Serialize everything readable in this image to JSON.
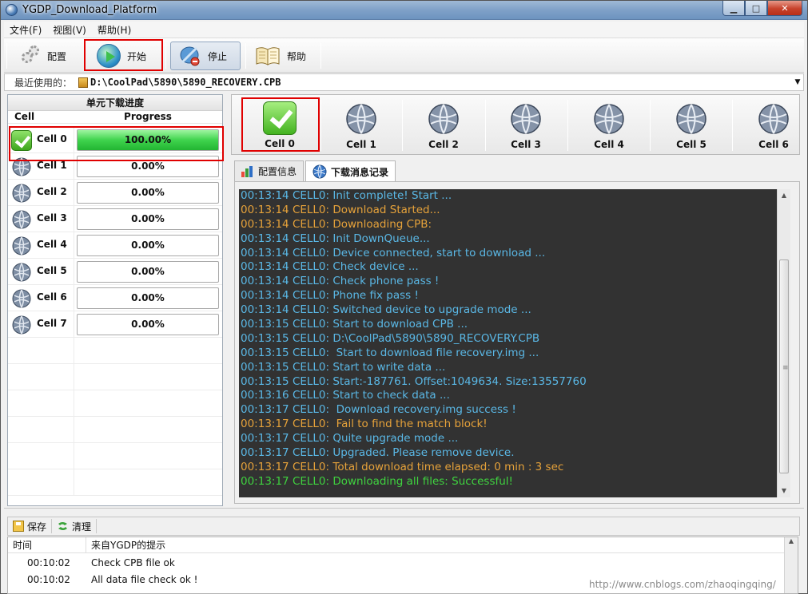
{
  "window": {
    "title": "YGDP_Download_Platform"
  },
  "menu": {
    "items": [
      "文件(F)",
      "视图(V)",
      "帮助(H)"
    ]
  },
  "toolbar": {
    "config": "配置",
    "start": "开始",
    "stop": "停止",
    "help": "帮助"
  },
  "recent": {
    "label": "最近使用的：",
    "path": "D:\\CoolPad\\5890\\5890_RECOVERY.CPB"
  },
  "left_panel": {
    "title": "单元下载进度",
    "col_cell": "Cell",
    "col_progress": "Progress",
    "cells": [
      {
        "name": "Cell 0",
        "progress": "100.00%",
        "done": true
      },
      {
        "name": "Cell 1",
        "progress": "0.00%"
      },
      {
        "name": "Cell 2",
        "progress": "0.00%"
      },
      {
        "name": "Cell 3",
        "progress": "0.00%"
      },
      {
        "name": "Cell 4",
        "progress": "0.00%"
      },
      {
        "name": "Cell 5",
        "progress": "0.00%"
      },
      {
        "name": "Cell 6",
        "progress": "0.00%"
      },
      {
        "name": "Cell 7",
        "progress": "0.00%"
      }
    ]
  },
  "cell_bar": [
    "Cell 0",
    "Cell 1",
    "Cell 2",
    "Cell 3",
    "Cell 4",
    "Cell 5",
    "Cell 6"
  ],
  "tabs": {
    "config_info": "配置信息",
    "download_log": "下载消息记录"
  },
  "log": [
    {
      "time": "00:13:14",
      "text": "CELL0: Init complete! Start ...",
      "color": "#5ab8e6"
    },
    {
      "time": "00:13:14",
      "text": "CELL0: Download Started...",
      "color": "#e6a23a"
    },
    {
      "time": "00:13:14",
      "text": "CELL0: Downloading CPB:",
      "color": "#e6a23a"
    },
    {
      "time": "00:13:14",
      "text": "CELL0: Init DownQueue...",
      "color": "#5ab8e6"
    },
    {
      "time": "00:13:14",
      "text": "CELL0: Device connected, start to download ...",
      "color": "#5ab8e6"
    },
    {
      "time": "00:13:14",
      "text": "CELL0: Check device ...",
      "color": "#5ab8e6"
    },
    {
      "time": "00:13:14",
      "text": "CELL0: Check phone pass !",
      "color": "#5ab8e6"
    },
    {
      "time": "00:13:14",
      "text": "CELL0: Phone fix pass !",
      "color": "#5ab8e6"
    },
    {
      "time": "00:13:14",
      "text": "CELL0: Switched device to upgrade mode ...",
      "color": "#5ab8e6"
    },
    {
      "time": "00:13:15",
      "text": "CELL0: Start to download CPB ...",
      "color": "#5ab8e6"
    },
    {
      "time": "00:13:15",
      "text": "CELL0: D:\\CoolPad\\5890\\5890_RECOVERY.CPB",
      "color": "#5ab8e6"
    },
    {
      "time": "00:13:15",
      "text": "CELL0:  Start to download file recovery.img ...",
      "color": "#5ab8e6"
    },
    {
      "time": "00:13:15",
      "text": "CELL0: Start to write data ...",
      "color": "#5ab8e6"
    },
    {
      "time": "00:13:15",
      "text": "CELL0: Start:-187761. Offset:1049634. Size:13557760",
      "color": "#5ab8e6"
    },
    {
      "time": "00:13:16",
      "text": "CELL0: Start to check data ...",
      "color": "#5ab8e6"
    },
    {
      "time": "00:13:17",
      "text": "CELL0:  Download recovery.img success !",
      "color": "#5ab8e6"
    },
    {
      "time": "00:13:17",
      "text": "CELL0:  Fail to find the match block!",
      "color": "#e6a23a"
    },
    {
      "time": "00:13:17",
      "text": "CELL0: Quite upgrade mode ...",
      "color": "#5ab8e6"
    },
    {
      "time": "00:13:17",
      "text": "CELL0: Upgraded. Please remove device.",
      "color": "#5ab8e6"
    },
    {
      "time": "00:13:17",
      "text": "CELL0: Total download time elapsed: 0 min : 3 sec",
      "color": "#e6a23a"
    },
    {
      "time": "00:13:17",
      "text": "CELL0: Downloading all files: Successful!",
      "color": "#3fd23f"
    }
  ],
  "bottom": {
    "save": "保存",
    "clear": "清理",
    "col_time": "时间",
    "col_msg": "来自YGDP的提示"
  },
  "messages": [
    {
      "time": "00:10:02",
      "text": "Check CPB file ok"
    },
    {
      "time": "00:10:02",
      "text": "All data file check ok !"
    }
  ],
  "watermark": "http://www.cnblogs.com/zhaoqingqing/"
}
